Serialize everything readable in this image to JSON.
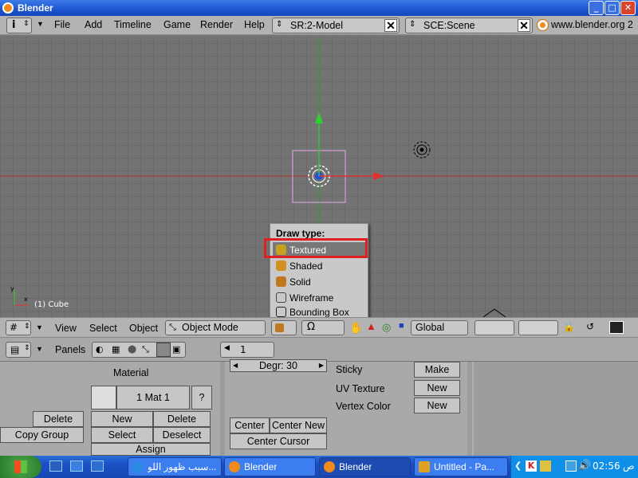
{
  "window": {
    "title": "Blender"
  },
  "top_menu": {
    "items": [
      "File",
      "Add",
      "Timeline",
      "Game",
      "Render",
      "Help"
    ],
    "screen_field": "SR:2-Model",
    "scene_field": "SCE:Scene",
    "website": "www.blender.org 2"
  },
  "viewport": {
    "object_label": "(1) Cube"
  },
  "draw_type_menu": {
    "title": "Draw type:",
    "items": [
      "Textured",
      "Shaded",
      "Solid",
      "Wireframe",
      "Bounding Box"
    ],
    "selected": "Textured"
  },
  "view_header": {
    "view": "View",
    "select": "Select",
    "object": "Object",
    "mode": "Object Mode",
    "orientation": "Global"
  },
  "buttons_header": {
    "panels": "Panels",
    "frame": "1"
  },
  "buttons": {
    "material_label": "Material",
    "mat_field": "1 Mat 1",
    "mat_query": "?",
    "delete_left": "Delete",
    "copy_group": "Copy Group",
    "new": "New",
    "delete": "Delete",
    "select": "Select",
    "deselect": "Deselect",
    "assign": "Assign",
    "degr": "Degr: 30",
    "center": "Center",
    "center_new": "Center New",
    "center_cursor": "Center Cursor",
    "sticky": "Sticky",
    "uv_texture": "UV Texture",
    "vertex_color": "Vertex Color",
    "make": "Make",
    "new2": "New",
    "new3": "New"
  },
  "taskbar": {
    "items": [
      "سبب ظهور اللو...",
      "Blender",
      "Blender",
      "Untitled - Pa..."
    ],
    "clock": "02:56",
    "ampm": "ص"
  },
  "colors": {
    "x_axis": "#e03030",
    "y_axis": "#30d030",
    "selection": "#e8a8e8",
    "highlight": "#e02020"
  }
}
